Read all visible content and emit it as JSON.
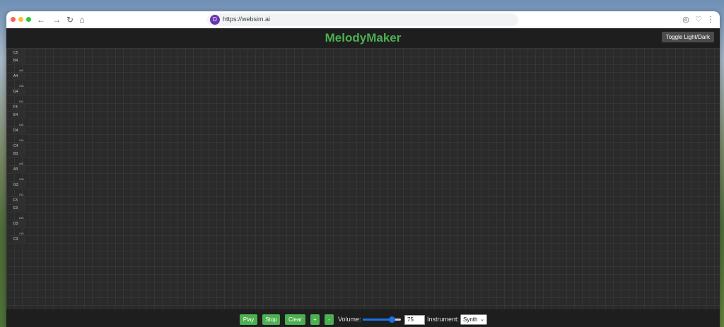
{
  "browser": {
    "url": "https://websim.ai",
    "favicon_letter": "D",
    "nav_icons": [
      "back-icon",
      "forward-icon",
      "reload-icon",
      "home-icon"
    ],
    "right_icons": [
      "extension-icon",
      "heart-icon",
      "more-icon"
    ]
  },
  "app": {
    "title": "MelodyMaker",
    "toggle_label": "Toggle Light/Dark",
    "accent_color": "#4caf50"
  },
  "piano_keys": [
    {
      "note": "C5",
      "type": "white"
    },
    {
      "note": "B4",
      "type": "white"
    },
    {
      "note": "A#4",
      "type": "black"
    },
    {
      "note": "A4",
      "type": "white"
    },
    {
      "note": "G#4",
      "type": "black"
    },
    {
      "note": "G4",
      "type": "white"
    },
    {
      "note": "F#4",
      "type": "black"
    },
    {
      "note": "F4",
      "type": "white"
    },
    {
      "note": "E4",
      "type": "white"
    },
    {
      "note": "D#4",
      "type": "black"
    },
    {
      "note": "D4",
      "type": "white"
    },
    {
      "note": "C#4",
      "type": "black"
    },
    {
      "note": "C4",
      "type": "white"
    },
    {
      "note": "B3",
      "type": "white"
    },
    {
      "note": "A#3",
      "type": "black"
    },
    {
      "note": "A3",
      "type": "white"
    },
    {
      "note": "G#3",
      "type": "black"
    },
    {
      "note": "G3",
      "type": "white"
    },
    {
      "note": "F#3",
      "type": "black"
    },
    {
      "note": "F3",
      "type": "white"
    },
    {
      "note": "E3",
      "type": "white"
    },
    {
      "note": "D#3",
      "type": "black"
    },
    {
      "note": "D3",
      "type": "white"
    },
    {
      "note": "C#3",
      "type": "black"
    },
    {
      "note": "C3",
      "type": "white"
    }
  ],
  "controls": {
    "play": "Play",
    "stop": "Stop",
    "clear": "Clear",
    "plus": "+",
    "minus": "-",
    "volume_label": "Volume:",
    "volume_value": "75",
    "volume_fraction": 0.75,
    "instrument_label": "Instrument:",
    "instrument_value": "Synth"
  }
}
